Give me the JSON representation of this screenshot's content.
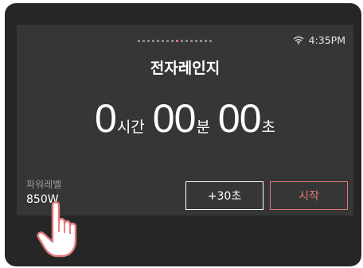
{
  "status": {
    "time": "4:35PM",
    "wifi_icon": "wifi-icon"
  },
  "pager": {
    "total": 16,
    "active_index": 8,
    "active_color": "#e57373"
  },
  "title": "전자레인지",
  "timer": {
    "hours": "0",
    "hours_unit": "시간",
    "minutes": "00",
    "minutes_unit": "분",
    "seconds": "00",
    "seconds_unit": "초"
  },
  "power": {
    "label": "파워레벨",
    "value": "850W"
  },
  "buttons": {
    "add30_label": "+30초",
    "start_label": "시작",
    "start_color": "#e07a7a"
  },
  "pointer_icon": "hand-pointer-icon"
}
